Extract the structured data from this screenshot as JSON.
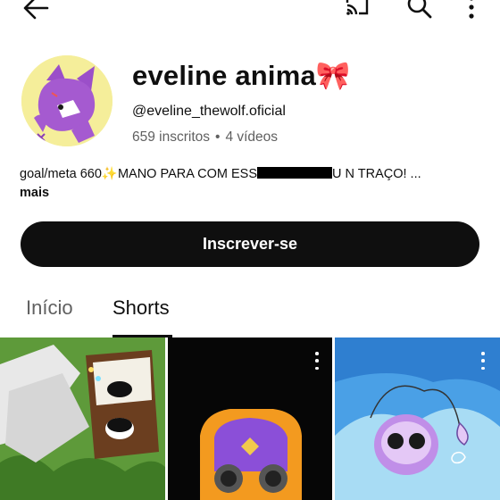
{
  "header": {
    "back_icon": "arrow-left-icon",
    "cast_icon": "cast-icon",
    "search_icon": "search-icon",
    "more_icon": "more-vertical-icon"
  },
  "channel": {
    "name": "eveline anima🎀",
    "handle": "@eveline_thewolf.oficial",
    "subscribers": "659 inscritos",
    "separator": "•",
    "videos": "4 vídeos",
    "description_start": "goal/meta 660✨MANO PARA COM ESS",
    "description_end": "U N TRAÇO! ...",
    "more_label": "mais"
  },
  "subscribe_button": {
    "label": "Inscrever-se"
  },
  "tabs": [
    {
      "label": "Início",
      "selected": false
    },
    {
      "label": "Shorts",
      "selected": true
    }
  ],
  "colors": {
    "accent": "#0f0f0f",
    "secondary_text": "#606060",
    "background": "#ffffff"
  }
}
